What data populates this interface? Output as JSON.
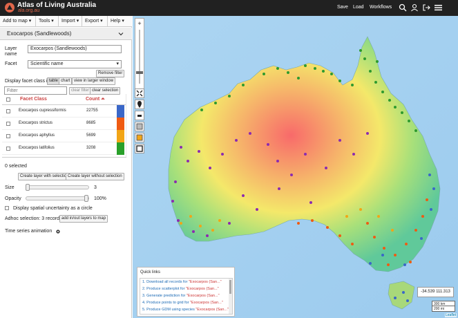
{
  "brand": {
    "title": "Atlas of Living Australia",
    "subtitle": "ala.org.au"
  },
  "topnav": {
    "save": "Save",
    "load": "Load",
    "workflows": "Workflows"
  },
  "icons": {
    "logo": "ala-logo-icon",
    "search": "search-icon",
    "user": "user-icon",
    "logout": "logout-icon",
    "menu": "hamburger-menu-icon"
  },
  "menubar": {
    "add_to_map": "Add to map ▾",
    "tools": "Tools ▾",
    "import": "Import ▾",
    "export": "Export ▾",
    "help": "Help ▾"
  },
  "layer": {
    "header": "Exocarpos (Sandlewoods)",
    "name_label_1": "Layer",
    "name_label_2": "name",
    "name_value": "Exocarpos (Sandlewoods)",
    "facet_label": "Facet",
    "facet_value": "Scientific name",
    "remove_filter": "Remove filter",
    "display_class_label": "Display facet class in",
    "btn_table": "table",
    "btn_chart": "chart",
    "btn_larger": "view in larger window",
    "filter_placeholder": "Filter",
    "btn_clear_filter": "clear filter",
    "btn_clear_selection": "clear selection"
  },
  "facet_table": {
    "col_class": "Facet Class",
    "col_count": "Count ⏶",
    "rows": [
      {
        "name": "Exocarpos cupressiformis",
        "count": "22755",
        "color": "#3a67c8"
      },
      {
        "name": "Exocarpos strictus",
        "count": "8685",
        "color": "#ef5b12"
      },
      {
        "name": "Exocarpos aphyllus",
        "count": "5699",
        "color": "#f2a516"
      },
      {
        "name": "Exocarpos latifolius",
        "count": "3208",
        "color": "#29a02a"
      }
    ]
  },
  "selection": {
    "selected_count": "0 selected",
    "btn_with": "Create layer with selection",
    "btn_without": "Create layer without selection"
  },
  "style": {
    "size_label": "Size",
    "size_value": "3",
    "opacity_label": "Opacity",
    "opacity_value": "100%",
    "uncertainty_label": "Display spatial uncertainty as a circle",
    "adhoc_label": "Adhoc selection: 3 record/s",
    "btn_adhoc": "add in/out layers to map",
    "time_series": "Time series animation"
  },
  "map": {
    "zoom_in": "+",
    "zoom_out": "−",
    "coords": "-34.539   111.313",
    "scale_km": "300 km",
    "scale_mi": "200 mi",
    "attribution": "Leaflet",
    "quick_links_title": "Quick links",
    "quick_links": [
      {
        "pre": "1. Download all records for ",
        "q": "\"Exocarpos (San...\""
      },
      {
        "pre": "2. Produce scatterplot for ",
        "q": "\"Exocarpos (San...\""
      },
      {
        "pre": "3. Generate prediction for ",
        "q": "\"Exocarpos (San...\""
      },
      {
        "pre": "4. Produce points to grid for ",
        "q": "\"Exocarpos (San...\""
      },
      {
        "pre": "5. Produce GDM using species ",
        "q": "\"Exocarpos (San...\""
      }
    ]
  }
}
